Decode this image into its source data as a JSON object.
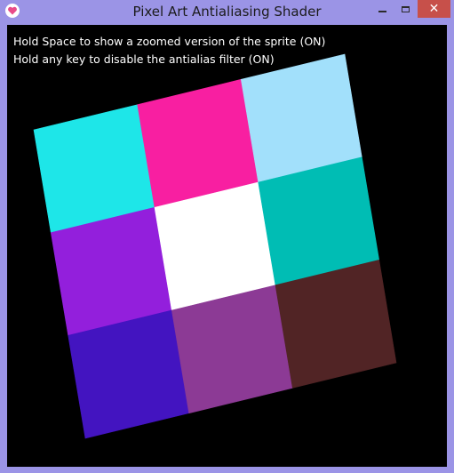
{
  "window": {
    "title": "Pixel Art Antialiasing Shader",
    "icon": "heart-app-icon",
    "controls": {
      "minimize": "minimize-icon",
      "maximize": "maximize-icon",
      "close": "✕"
    }
  },
  "info": {
    "line1": "Hold Space to show a zoomed version of the sprite (ON)",
    "line2": "Hold any key to disable the antialias filter (ON)"
  },
  "sprite": {
    "grid": [
      [
        "#1ee6e8",
        "#f81fa1",
        "#a2e0fb"
      ],
      [
        "#931fdc",
        "#ffffff",
        "#00bdb4"
      ],
      [
        "#4314c0",
        "#8c3a95",
        "#512425"
      ]
    ]
  }
}
